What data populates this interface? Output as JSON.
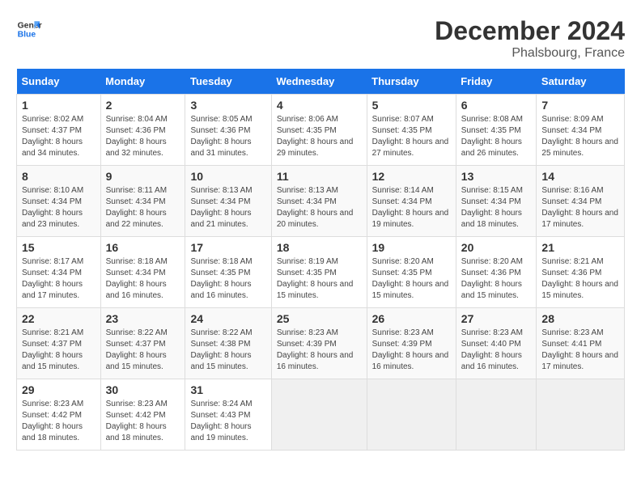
{
  "header": {
    "logo_line1": "General",
    "logo_line2": "Blue",
    "month": "December 2024",
    "location": "Phalsbourg, France"
  },
  "days_of_week": [
    "Sunday",
    "Monday",
    "Tuesday",
    "Wednesday",
    "Thursday",
    "Friday",
    "Saturday"
  ],
  "weeks": [
    [
      {
        "day": "1",
        "sunrise": "8:02 AM",
        "sunset": "4:37 PM",
        "daylight": "8 hours and 34 minutes."
      },
      {
        "day": "2",
        "sunrise": "8:04 AM",
        "sunset": "4:36 PM",
        "daylight": "8 hours and 32 minutes."
      },
      {
        "day": "3",
        "sunrise": "8:05 AM",
        "sunset": "4:36 PM",
        "daylight": "8 hours and 31 minutes."
      },
      {
        "day": "4",
        "sunrise": "8:06 AM",
        "sunset": "4:35 PM",
        "daylight": "8 hours and 29 minutes."
      },
      {
        "day": "5",
        "sunrise": "8:07 AM",
        "sunset": "4:35 PM",
        "daylight": "8 hours and 27 minutes."
      },
      {
        "day": "6",
        "sunrise": "8:08 AM",
        "sunset": "4:35 PM",
        "daylight": "8 hours and 26 minutes."
      },
      {
        "day": "7",
        "sunrise": "8:09 AM",
        "sunset": "4:34 PM",
        "daylight": "8 hours and 25 minutes."
      }
    ],
    [
      {
        "day": "8",
        "sunrise": "8:10 AM",
        "sunset": "4:34 PM",
        "daylight": "8 hours and 23 minutes."
      },
      {
        "day": "9",
        "sunrise": "8:11 AM",
        "sunset": "4:34 PM",
        "daylight": "8 hours and 22 minutes."
      },
      {
        "day": "10",
        "sunrise": "8:13 AM",
        "sunset": "4:34 PM",
        "daylight": "8 hours and 21 minutes."
      },
      {
        "day": "11",
        "sunrise": "8:13 AM",
        "sunset": "4:34 PM",
        "daylight": "8 hours and 20 minutes."
      },
      {
        "day": "12",
        "sunrise": "8:14 AM",
        "sunset": "4:34 PM",
        "daylight": "8 hours and 19 minutes."
      },
      {
        "day": "13",
        "sunrise": "8:15 AM",
        "sunset": "4:34 PM",
        "daylight": "8 hours and 18 minutes."
      },
      {
        "day": "14",
        "sunrise": "8:16 AM",
        "sunset": "4:34 PM",
        "daylight": "8 hours and 17 minutes."
      }
    ],
    [
      {
        "day": "15",
        "sunrise": "8:17 AM",
        "sunset": "4:34 PM",
        "daylight": "8 hours and 17 minutes."
      },
      {
        "day": "16",
        "sunrise": "8:18 AM",
        "sunset": "4:34 PM",
        "daylight": "8 hours and 16 minutes."
      },
      {
        "day": "17",
        "sunrise": "8:18 AM",
        "sunset": "4:35 PM",
        "daylight": "8 hours and 16 minutes."
      },
      {
        "day": "18",
        "sunrise": "8:19 AM",
        "sunset": "4:35 PM",
        "daylight": "8 hours and 15 minutes."
      },
      {
        "day": "19",
        "sunrise": "8:20 AM",
        "sunset": "4:35 PM",
        "daylight": "8 hours and 15 minutes."
      },
      {
        "day": "20",
        "sunrise": "8:20 AM",
        "sunset": "4:36 PM",
        "daylight": "8 hours and 15 minutes."
      },
      {
        "day": "21",
        "sunrise": "8:21 AM",
        "sunset": "4:36 PM",
        "daylight": "8 hours and 15 minutes."
      }
    ],
    [
      {
        "day": "22",
        "sunrise": "8:21 AM",
        "sunset": "4:37 PM",
        "daylight": "8 hours and 15 minutes."
      },
      {
        "day": "23",
        "sunrise": "8:22 AM",
        "sunset": "4:37 PM",
        "daylight": "8 hours and 15 minutes."
      },
      {
        "day": "24",
        "sunrise": "8:22 AM",
        "sunset": "4:38 PM",
        "daylight": "8 hours and 15 minutes."
      },
      {
        "day": "25",
        "sunrise": "8:23 AM",
        "sunset": "4:39 PM",
        "daylight": "8 hours and 16 minutes."
      },
      {
        "day": "26",
        "sunrise": "8:23 AM",
        "sunset": "4:39 PM",
        "daylight": "8 hours and 16 minutes."
      },
      {
        "day": "27",
        "sunrise": "8:23 AM",
        "sunset": "4:40 PM",
        "daylight": "8 hours and 16 minutes."
      },
      {
        "day": "28",
        "sunrise": "8:23 AM",
        "sunset": "4:41 PM",
        "daylight": "8 hours and 17 minutes."
      }
    ],
    [
      {
        "day": "29",
        "sunrise": "8:23 AM",
        "sunset": "4:42 PM",
        "daylight": "8 hours and 18 minutes."
      },
      {
        "day": "30",
        "sunrise": "8:23 AM",
        "sunset": "4:42 PM",
        "daylight": "8 hours and 18 minutes."
      },
      {
        "day": "31",
        "sunrise": "8:24 AM",
        "sunset": "4:43 PM",
        "daylight": "8 hours and 19 minutes."
      },
      null,
      null,
      null,
      null
    ]
  ]
}
